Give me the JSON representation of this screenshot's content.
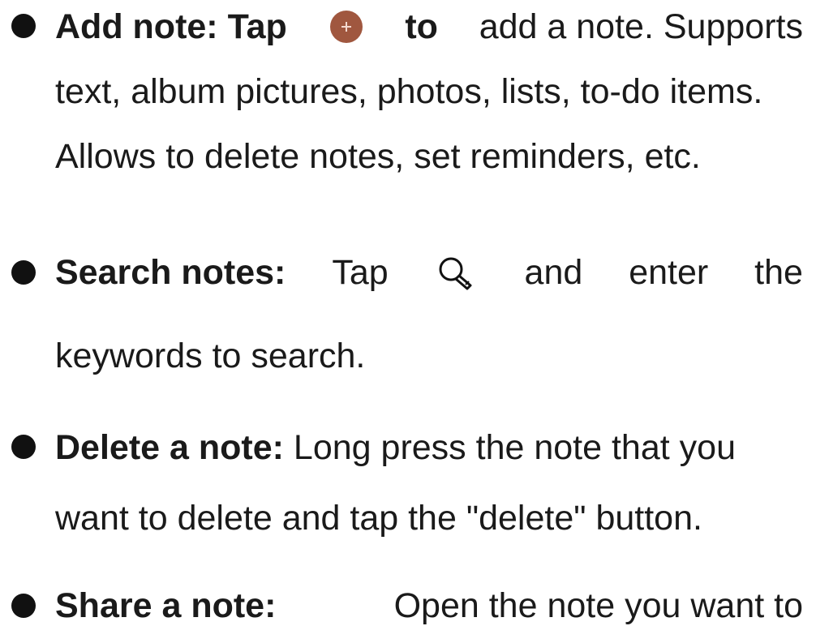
{
  "items": [
    {
      "bold": "Add note: Tap",
      "icon": "plus-circle-icon",
      "bold_after_icon": "to",
      "text": [
        "add a note. Supports",
        "text, album pictures, photos, lists, to-do items.",
        "Allows to delete notes, set reminders, etc."
      ]
    },
    {
      "bold": "Search notes:",
      "text_before_icon": "Tap",
      "icon": "search-icon",
      "words": [
        "and",
        "enter",
        "the"
      ],
      "text": [
        "keywords to search."
      ]
    },
    {
      "bold": "Delete a note:",
      "text": [
        "Long press the note that you",
        "want to delete and tap the \"delete\" button."
      ]
    },
    {
      "bold": "Share a note:",
      "text": [
        "Open the note you want to"
      ]
    }
  ],
  "colors": {
    "plus_icon": "#a0573f",
    "text": "#1a1a1a"
  }
}
